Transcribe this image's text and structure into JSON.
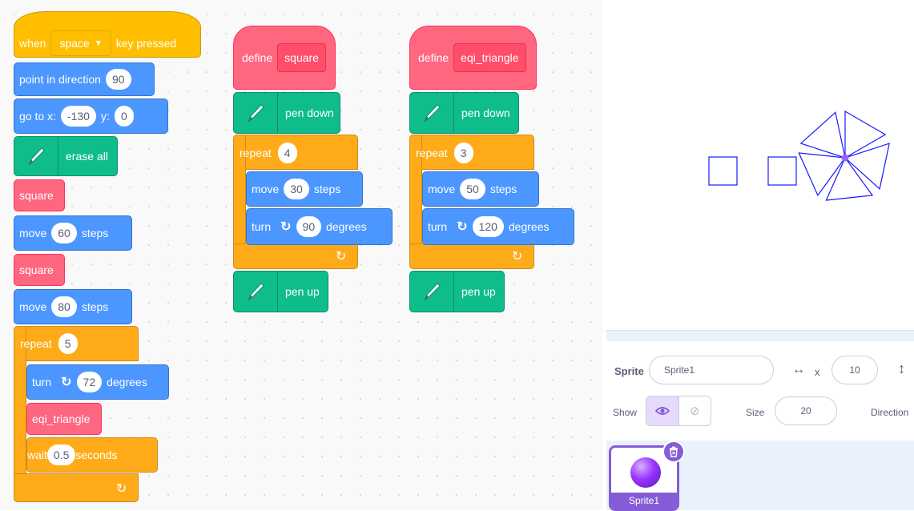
{
  "script_main": {
    "when": "when",
    "key": "space",
    "key_pressed": "key pressed",
    "point_dir": "point in direction",
    "dir_val": "90",
    "goto": "go to x:",
    "goto_x": "-130",
    "goto_y_lbl": "y:",
    "goto_y": "0",
    "erase_all": "erase all",
    "square1": "square",
    "move1": "move",
    "move1_val": "60",
    "steps1": "steps",
    "square2": "square",
    "move2": "move",
    "move2_val": "80",
    "steps2": "steps",
    "repeat": "repeat",
    "repeat_val": "5",
    "turn": "turn",
    "turn_val": "72",
    "degrees": "degrees",
    "eqi": "eqi_triangle",
    "wait": "wait",
    "wait_val": "0.5",
    "seconds": "seconds"
  },
  "script_square": {
    "define": "define",
    "name": "square",
    "pen_down": "pen down",
    "repeat": "repeat",
    "repeat_val": "4",
    "move": "move",
    "move_val": "30",
    "steps": "steps",
    "turn": "turn",
    "turn_val": "90",
    "degrees": "degrees",
    "pen_up": "pen up"
  },
  "script_triangle": {
    "define": "define",
    "name": "eqi_triangle",
    "pen_down": "pen down",
    "repeat": "repeat",
    "repeat_val": "3",
    "move": "move",
    "move_val": "50",
    "steps": "steps",
    "turn": "turn",
    "turn_val": "120",
    "degrees": "degrees",
    "pen_up": "pen up"
  },
  "sprite_info": {
    "sprite_label": "Sprite",
    "sprite_name": "Sprite1",
    "x_label": "x",
    "x_val": "10",
    "show_label": "Show",
    "size_label": "Size",
    "size_val": "20",
    "direction_label": "Direction"
  },
  "sprite_list": {
    "thumb_name": "Sprite1"
  },
  "colors": {
    "motion": "#4c97ff",
    "events": "#ffbf00",
    "control": "#ffab19",
    "custom": "#ff6680",
    "pen": "#0fbd8c",
    "accent": "#855cd6"
  }
}
